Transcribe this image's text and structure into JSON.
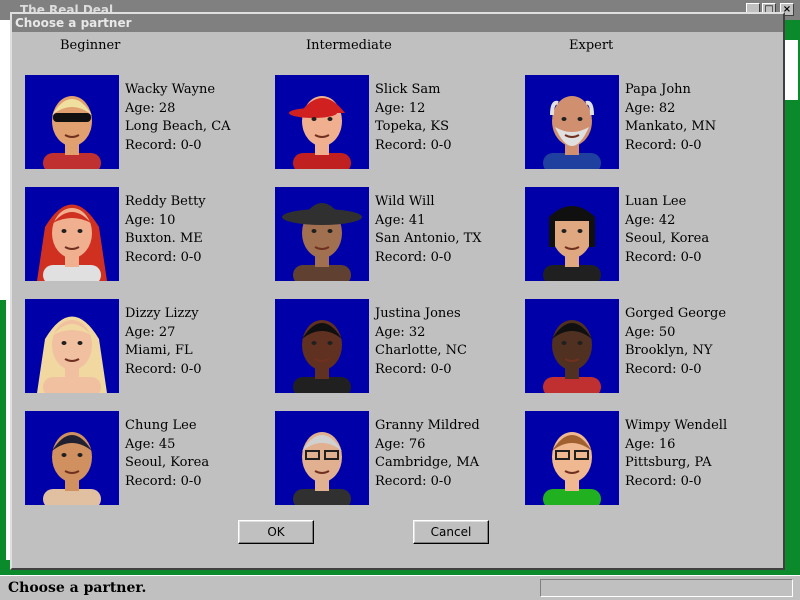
{
  "app": {
    "title": "The Real Deal"
  },
  "dialog": {
    "title": "Choose a partner",
    "ok_label": "OK",
    "cancel_label": "Cancel"
  },
  "levels": [
    {
      "label": "Beginner"
    },
    {
      "label": "Intermediate"
    },
    {
      "label": "Expert"
    }
  ],
  "partners": [
    {
      "name": "Wacky Wayne",
      "age": "Age: 28",
      "home": "Long Beach, CA",
      "record": "Record: 0-0",
      "hair": "#f0e0a0",
      "skin": "#e0a070",
      "shirt": "#c03030",
      "glasses": "sunglasses"
    },
    {
      "name": "Slick Sam",
      "age": "Age: 12",
      "home": "Topeka, KS",
      "record": "Record: 0-0",
      "hair": "#d02020",
      "skin": "#f0b090",
      "shirt": "#c02020",
      "glasses": "cap"
    },
    {
      "name": "Papa John",
      "age": "Age: 82",
      "home": "Mankato, MN",
      "record": "Record: 0-0",
      "hair": "#e0e0e0",
      "skin": "#d09070",
      "shirt": "#2040a0",
      "glasses": "beard"
    },
    {
      "name": "Reddy Betty",
      "age": "Age: 10",
      "home": "Buxton. ME",
      "record": "Record: 0-0",
      "hair": "#d03020",
      "skin": "#f0b090",
      "shirt": "#e0e0e0",
      "glasses": "longhair"
    },
    {
      "name": "Wild Will",
      "age": "Age: 41",
      "home": "San Antonio, TX",
      "record": "Record: 0-0",
      "hair": "#303030",
      "skin": "#a07050",
      "shirt": "#604030",
      "glasses": "hat"
    },
    {
      "name": "Luan Lee",
      "age": "Age: 42",
      "home": "Seoul, Korea",
      "record": "Record: 0-0",
      "hair": "#101010",
      "skin": "#e0a880",
      "shirt": "#202020",
      "glasses": "bob"
    },
    {
      "name": "Dizzy Lizzy",
      "age": "Age: 27",
      "home": "Miami, FL",
      "record": "Record: 0-0",
      "hair": "#f0d8a0",
      "skin": "#f0c0a0",
      "shirt": "#f0c0a0",
      "glasses": "longhair"
    },
    {
      "name": "Justina Jones",
      "age": "Age: 32",
      "home": "Charlotte, NC",
      "record": "Record: 0-0",
      "hair": "#101010",
      "skin": "#603020",
      "shirt": "#202020",
      "glasses": "none"
    },
    {
      "name": "Gorged George",
      "age": "Age: 50",
      "home": "Brooklyn, NY",
      "record": "Record: 0-0",
      "hair": "#101010",
      "skin": "#503020",
      "shirt": "#c03030",
      "glasses": "none"
    },
    {
      "name": "Chung Lee",
      "age": "Age: 45",
      "home": "Seoul, Korea",
      "record": "Record: 0-0",
      "hair": "#202030",
      "skin": "#d09060",
      "shirt": "#e0c0a0",
      "glasses": "none"
    },
    {
      "name": "Granny Mildred",
      "age": "Age: 76",
      "home": "Cambridge, MA",
      "record": "Record: 0-0",
      "hair": "#d0d0d0",
      "skin": "#e0b090",
      "shirt": "#303030",
      "glasses": "glasses"
    },
    {
      "name": "Wimpy Wendell",
      "age": "Age: 16",
      "home": "Pittsburg, PA",
      "record": "Record: 0-0",
      "hair": "#a06030",
      "skin": "#f0b890",
      "shirt": "#20b020",
      "glasses": "glasses"
    }
  ],
  "status": {
    "text": "Choose a partner."
  },
  "colors": {
    "portrait_bg": "#0000a8",
    "dialog_bg": "#c0c0c0",
    "felt": "#0a8a2a"
  }
}
